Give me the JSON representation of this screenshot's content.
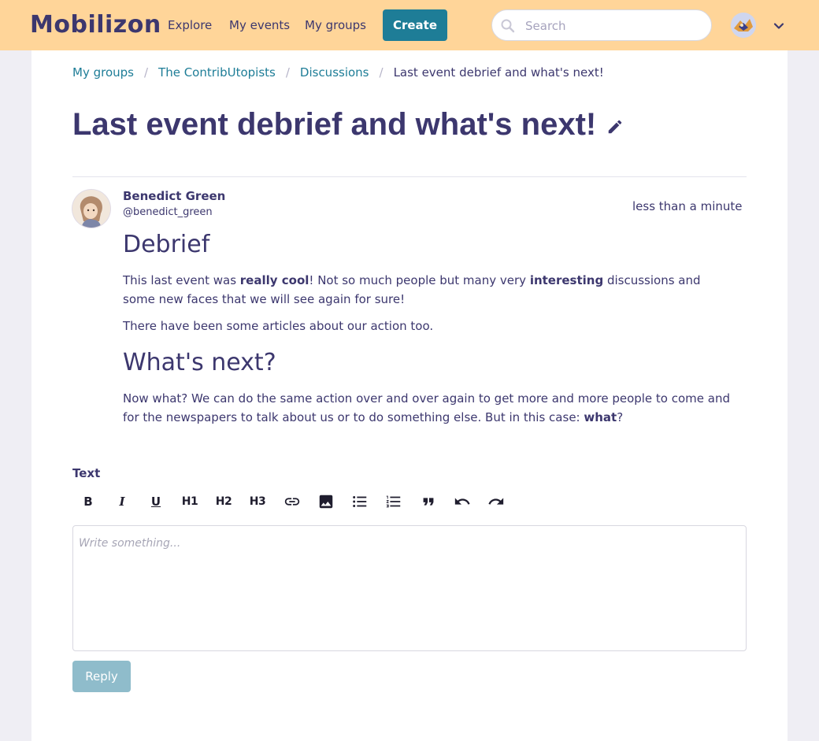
{
  "navbar": {
    "logo": "Mobilizon",
    "links": [
      "Explore",
      "My events",
      "My groups"
    ],
    "create_label": "Create",
    "search_placeholder": "Search"
  },
  "breadcrumb": {
    "items": [
      "My groups",
      "The ContribUtopists",
      "Discussions"
    ],
    "current": "Last event debrief and what's next!"
  },
  "discussion": {
    "title": "Last event debrief and what's next!"
  },
  "comment": {
    "author_name": "Benedict Green",
    "author_handle": "@benedict_green",
    "timestamp": "less than a minute",
    "heading1": "Debrief",
    "p1_a": "This last event was ",
    "p1_b": "really cool",
    "p1_c": "! Not so much people but many very ",
    "p1_d": "interesting",
    "p1_e": " discussions and some new faces that we will see again for sure!",
    "p2": "There have been some articles about our action too.",
    "heading2": "What's next?",
    "p3_a": "Now what? We can do the same action over and over again to get more and more people to come and for the newspapers to talk about us or to do something else. But in this case: ",
    "p3_b": "what",
    "p3_c": "?"
  },
  "editor": {
    "label": "Text",
    "toolbar": {
      "bold": "B",
      "italic": "I",
      "underline": "U",
      "h1": "H1",
      "h2": "H2",
      "h3": "H3"
    },
    "toolbar_icons": [
      "bold-icon",
      "italic-icon",
      "underline-icon",
      "h1",
      "h2",
      "h3",
      "link-icon",
      "image-icon",
      "bullet-list-icon",
      "numbered-list-icon",
      "quote-icon",
      "undo-icon",
      "redo-icon"
    ],
    "placeholder": "Write something...",
    "reply_label": "Reply"
  },
  "colors": {
    "navbar_bg": "#ffd599",
    "primary": "#1e7d97",
    "text": "#3c376e",
    "reply_disabled": "#8fbccb"
  }
}
